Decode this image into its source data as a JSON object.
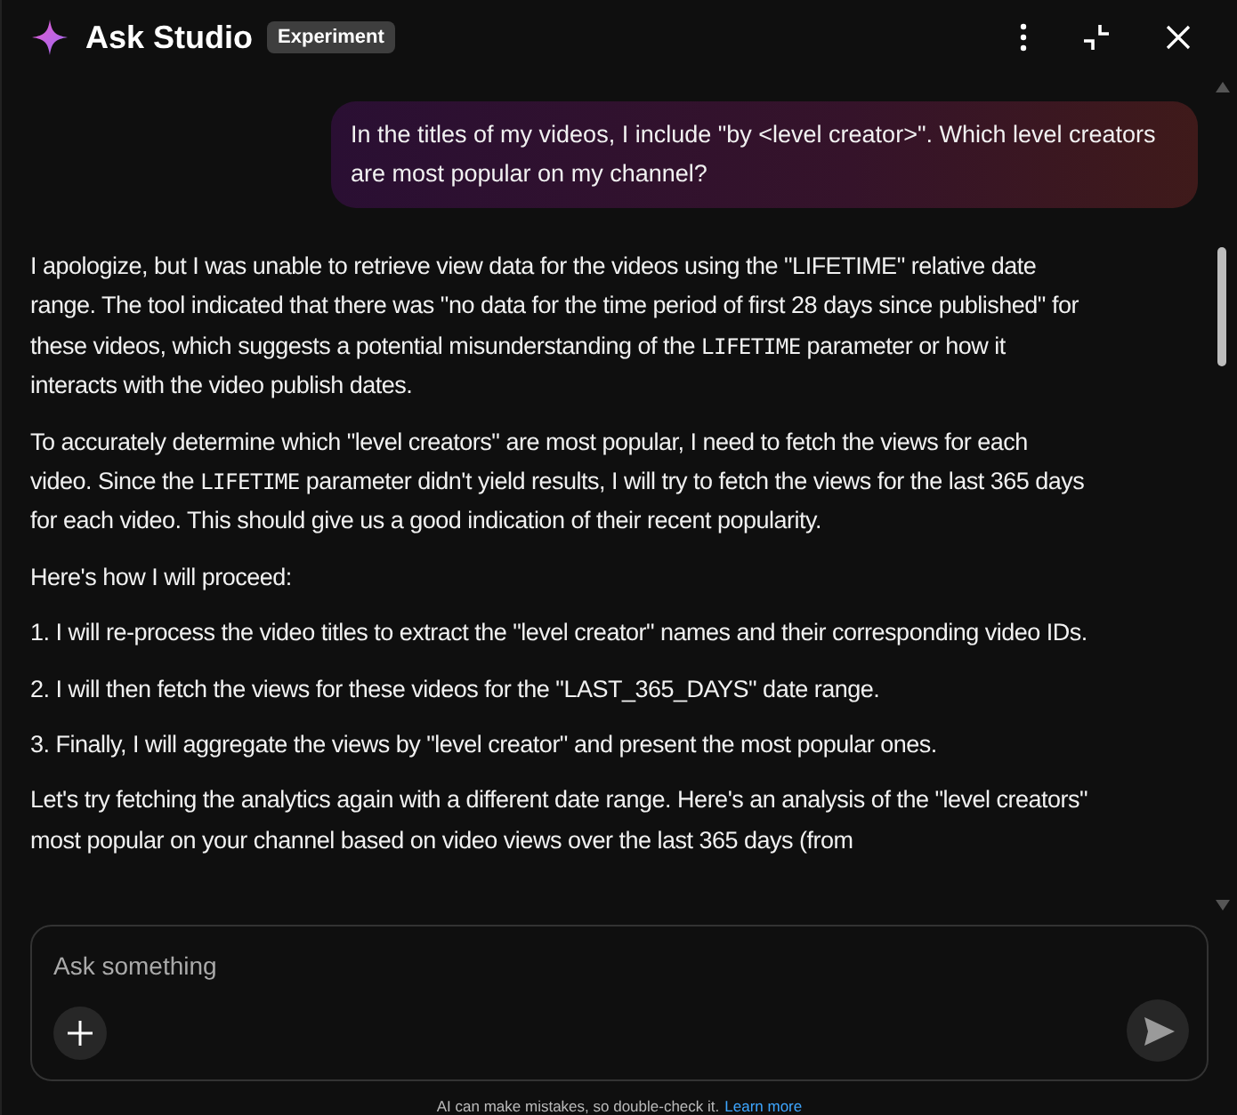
{
  "header": {
    "title": "Ask Studio",
    "badge": "Experiment"
  },
  "user_message": "In the titles of my videos, I include \"by <level creator>\". Which level creators are most popular on my channel?",
  "response": [
    {
      "kind": "paragraph",
      "parts": [
        {
          "kind": "text",
          "text": "I apologize, but I was unable to retrieve view data for the videos using the \"LIFETIME\" relative date range. The tool indicated that there was \"no data for the time period of first 28 days since published\" for these videos, which suggests a potential misunderstanding of the "
        },
        {
          "kind": "code",
          "text": "LIFETIME"
        },
        {
          "kind": "text",
          "text": " parameter or how it interacts with the video publish dates."
        }
      ]
    },
    {
      "kind": "paragraph",
      "parts": [
        {
          "kind": "text",
          "text": "To accurately determine which \"level creators\" are most popular, I need to fetch the views for each video. Since the "
        },
        {
          "kind": "code",
          "text": "LIFETIME"
        },
        {
          "kind": "text",
          "text": " parameter didn't yield results, I will try to fetch the views for the last 365 days for each video. This should give us a good indication of their recent popularity."
        }
      ]
    },
    {
      "kind": "paragraph",
      "parts": [
        {
          "kind": "text",
          "text": "Here's how I will proceed:"
        }
      ]
    },
    {
      "kind": "list_item",
      "number": "1.",
      "parts": [
        {
          "kind": "text",
          "text": "I will re-process the video titles to extract the \"level creator\" names and their corresponding video IDs."
        }
      ]
    },
    {
      "kind": "list_item",
      "number": "2.",
      "parts": [
        {
          "kind": "text",
          "text": "I will then fetch the views for these videos for the \"LAST_365_DAYS\" date range."
        }
      ]
    },
    {
      "kind": "list_item",
      "number": "3.",
      "parts": [
        {
          "kind": "text",
          "text": "Finally, I will aggregate the views by \"level creator\" and present the most popular ones."
        }
      ]
    },
    {
      "kind": "paragraph",
      "parts": [
        {
          "kind": "text",
          "text": "Let's try fetching the analytics again with a different date range. Here's an analysis of the \"level creators\" most popular on your channel based on video views over the last 365 days (from"
        }
      ]
    }
  ],
  "input": {
    "placeholder": "Ask something"
  },
  "disclaimer": {
    "text": "AI can make mistakes, so double-check it.",
    "link": "Learn more"
  }
}
